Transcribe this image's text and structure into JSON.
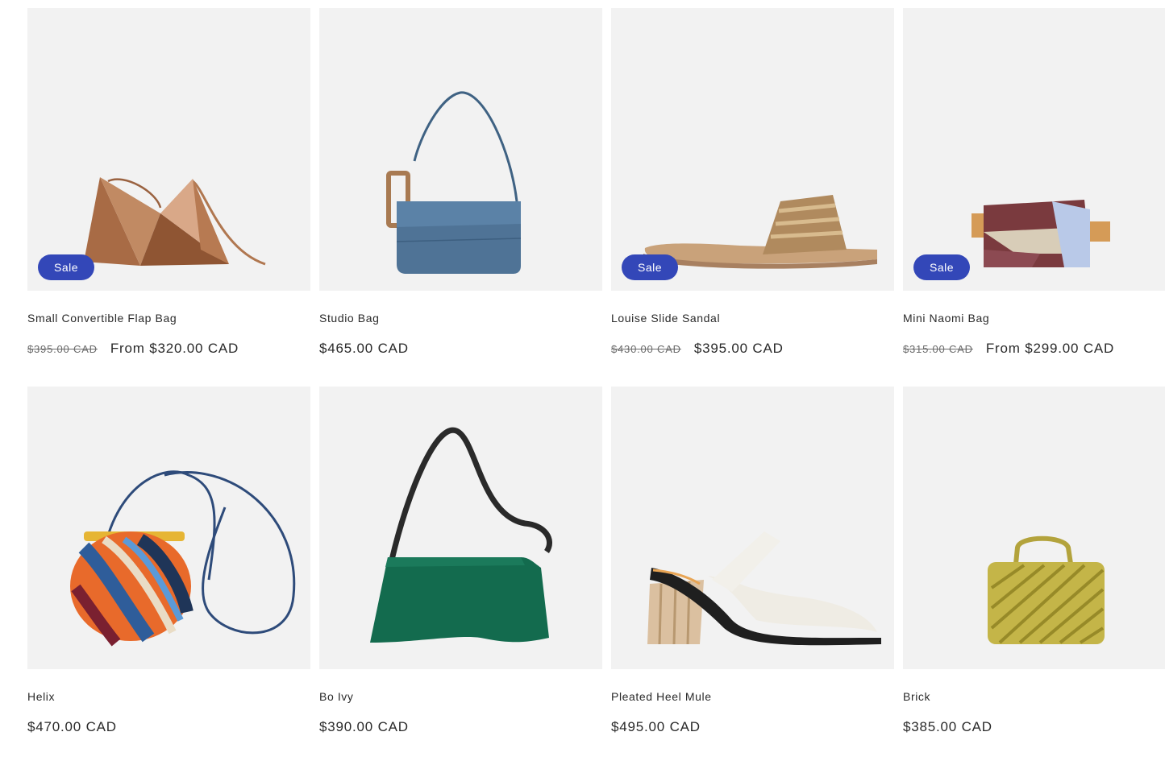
{
  "badge_label": "Sale",
  "products": [
    {
      "title": "Small Convertible Flap Bag",
      "compare_price": "$395.00 CAD",
      "price": "From $320.00 CAD",
      "sale": true,
      "image": "origami-triangle-bag-icon"
    },
    {
      "title": "Studio Bag",
      "compare_price": "",
      "price": "$465.00 CAD",
      "sale": false,
      "image": "blue-shoulder-bag-icon"
    },
    {
      "title": "Louise Slide Sandal",
      "compare_price": "$430.00 CAD",
      "price": "$395.00 CAD",
      "sale": true,
      "image": "slide-sandal-icon"
    },
    {
      "title": "Mini Naomi Bag",
      "compare_price": "$315.00 CAD",
      "price": "From $299.00 CAD",
      "sale": true,
      "image": "colorblock-belt-bag-icon"
    },
    {
      "title": "Helix",
      "compare_price": "",
      "price": "$470.00 CAD",
      "sale": false,
      "image": "striped-round-bag-icon"
    },
    {
      "title": "Bo Ivy",
      "compare_price": "",
      "price": "$390.00 CAD",
      "sale": false,
      "image": "green-shoulder-bag-icon"
    },
    {
      "title": "Pleated Heel Mule",
      "compare_price": "",
      "price": "$495.00 CAD",
      "sale": false,
      "image": "pleated-heel-mule-icon"
    },
    {
      "title": "Brick",
      "compare_price": "",
      "price": "$385.00 CAD",
      "sale": false,
      "image": "quilted-handbag-icon"
    }
  ],
  "colors": {
    "badge": "#3347b8",
    "tile_background": "#f2f2f2",
    "text": "#2a2a2a",
    "compare_price": "#6b6b6b"
  }
}
